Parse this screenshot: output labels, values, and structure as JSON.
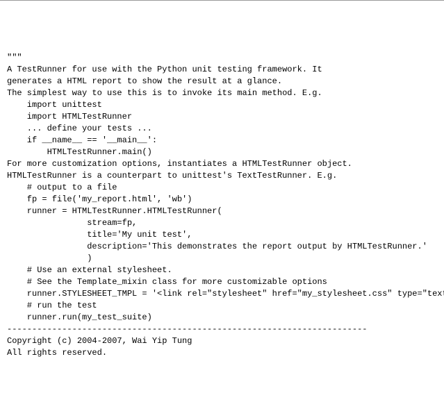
{
  "doc": {
    "lines": [
      "\"\"\"",
      "A TestRunner for use with the Python unit testing framework. It",
      "generates a HTML report to show the result at a glance.",
      "",
      "The simplest way to use this is to invoke its main method. E.g.",
      "",
      "    import unittest",
      "    import HTMLTestRunner",
      "",
      "    ... define your tests ...",
      "",
      "    if __name__ == '__main__':",
      "        HTMLTestRunner.main()",
      "",
      "",
      "For more customization options, instantiates a HTMLTestRunner object.",
      "HTMLTestRunner is a counterpart to unittest's TextTestRunner. E.g.",
      "",
      "    # output to a file",
      "    fp = file('my_report.html', 'wb')",
      "    runner = HTMLTestRunner.HTMLTestRunner(",
      "                stream=fp,",
      "                title='My unit test',",
      "                description='This demonstrates the report output by HTMLTestRunner.'",
      "                )",
      "",
      "    # Use an external stylesheet.",
      "    # See the Template_mixin class for more customizable options",
      "    runner.STYLESHEET_TMPL = '<link rel=\"stylesheet\" href=\"my_stylesheet.css\" type=\"text/css\">'",
      "",
      "    # run the test",
      "    runner.run(my_test_suite)",
      "",
      "",
      "------------------------------------------------------------------------",
      "Copyright (c) 2004-2007, Wai Yip Tung",
      "All rights reserved."
    ]
  }
}
